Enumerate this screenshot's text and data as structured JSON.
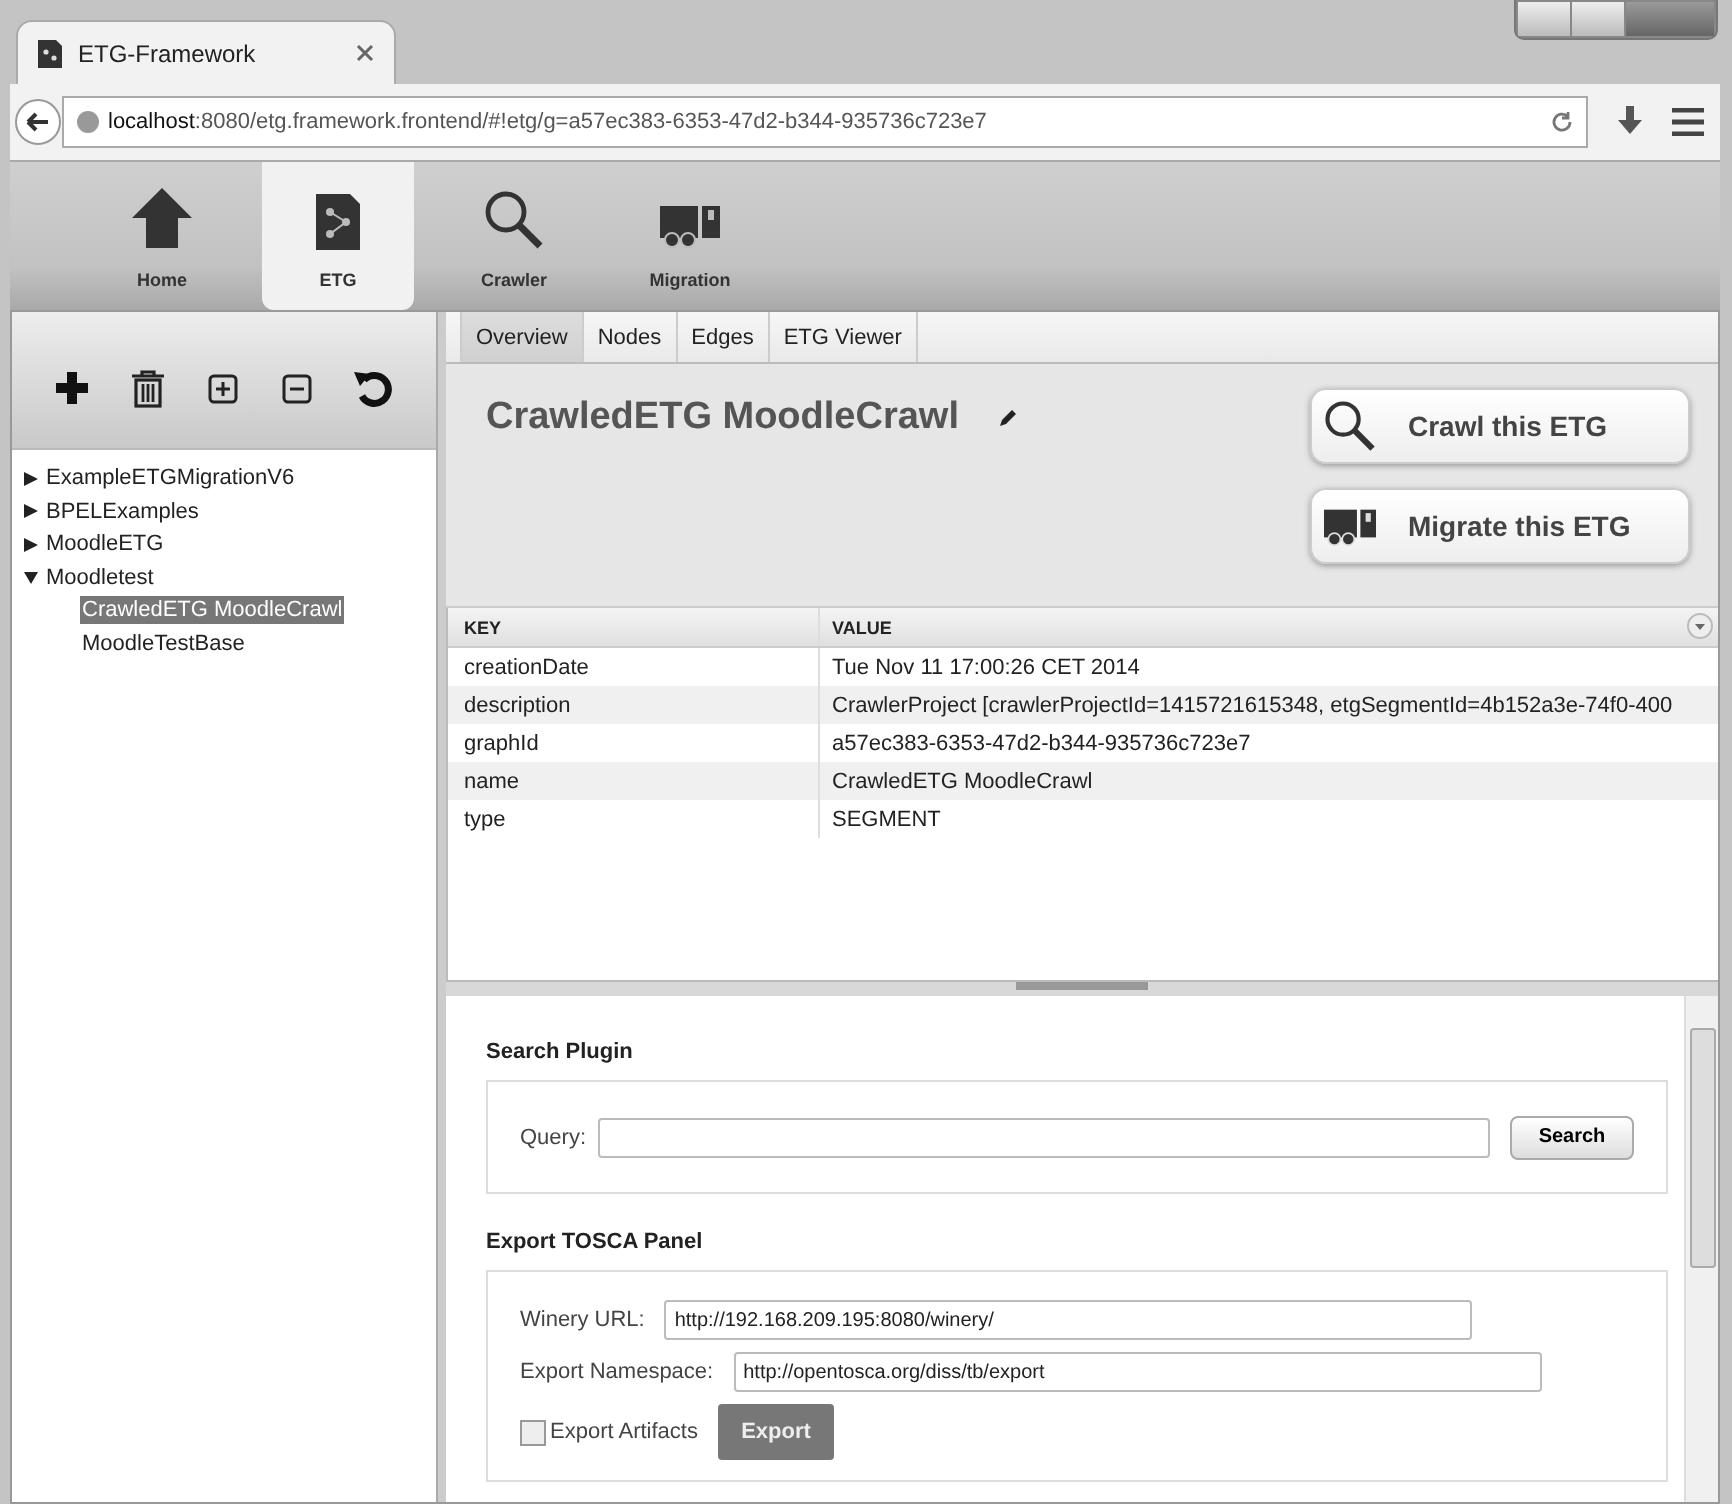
{
  "browser": {
    "tab_title": "ETG-Framework",
    "url_host": "localhost",
    "url_rest": ":8080/etg.framework.frontend/#!etg/g=a57ec383-6353-47d2-b344-935736c723e7"
  },
  "nav": [
    {
      "kind": "home",
      "label": "Home",
      "selected": false
    },
    {
      "kind": "etg",
      "label": "ETG",
      "selected": true
    },
    {
      "kind": "crawler",
      "label": "Crawler",
      "selected": false
    },
    {
      "kind": "migration",
      "label": "Migration",
      "selected": false
    }
  ],
  "tree": [
    {
      "label": "ExampleETGMigrationV6",
      "expanded": false,
      "selected": false
    },
    {
      "label": "BPELExamples",
      "expanded": false,
      "selected": false
    },
    {
      "label": "MoodleETG",
      "expanded": false,
      "selected": false
    },
    {
      "label": "Moodletest",
      "expanded": true,
      "selected": false,
      "children": [
        {
          "label": "CrawledETG MoodleCrawl",
          "selected": true
        },
        {
          "label": "MoodleTestBase",
          "selected": false
        }
      ]
    }
  ],
  "tabs": [
    {
      "label": "Overview",
      "selected": true
    },
    {
      "label": "Nodes",
      "selected": false
    },
    {
      "label": "Edges",
      "selected": false
    },
    {
      "label": "ETG Viewer",
      "selected": false
    }
  ],
  "title": "CrawledETG MoodleCrawl",
  "actions": [
    {
      "kind": "crawl",
      "label": "Crawl this ETG"
    },
    {
      "kind": "migrate",
      "label": "Migrate this ETG"
    }
  ],
  "table": {
    "columns": [
      "KEY",
      "VALUE"
    ],
    "rows": [
      [
        "creationDate",
        "Tue Nov 11 17:00:26 CET 2014"
      ],
      [
        "description",
        "CrawlerProject [crawlerProjectId=1415721615348, etgSegmentId=4b152a3e-74f0-400"
      ],
      [
        "graphId",
        "a57ec383-6353-47d2-b344-935736c723e7"
      ],
      [
        "name",
        "CrawledETG MoodleCrawl"
      ],
      [
        "type",
        "SEGMENT"
      ]
    ]
  },
  "search_plugin": {
    "title": "Search Plugin",
    "query_label": "Query:",
    "button": "Search"
  },
  "export_panel": {
    "title": "Export TOSCA Panel",
    "winery_label": "Winery URL:",
    "winery_value": "http://192.168.209.195:8080/winery/",
    "namespace_label": "Export Namespace:",
    "namespace_value": "http://opentosca.org/diss/tb/export",
    "artifacts_label": "Export Artifacts",
    "artifacts_checked": false,
    "button": "Export"
  }
}
